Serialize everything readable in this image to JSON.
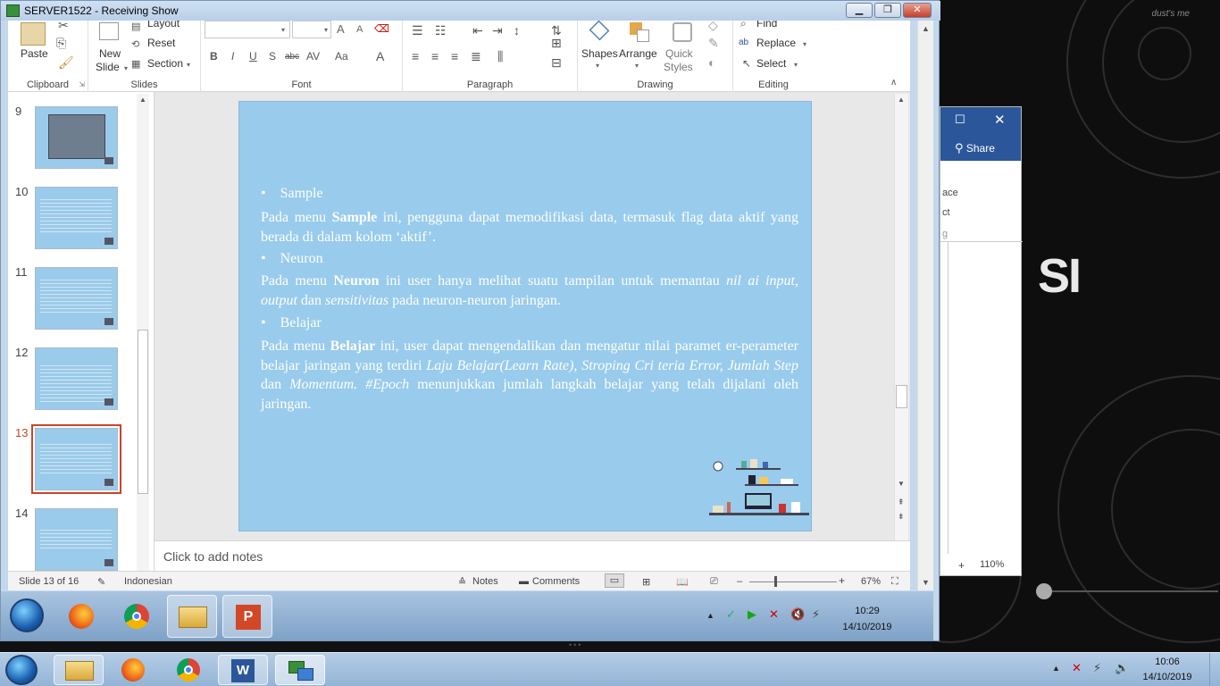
{
  "remote_window": {
    "title": "SERVER1522 - Receiving Show"
  },
  "ribbon": {
    "clipboard": {
      "paste": "Paste",
      "label": "Clipboard"
    },
    "slides": {
      "new_slide_1": "New",
      "new_slide_2": "Slide",
      "layout": "Layout",
      "reset": "Reset",
      "section": "Section",
      "label": "Slides"
    },
    "font": {
      "label": "Font",
      "bold": "B",
      "italic": "I",
      "underline": "U",
      "shadow": "S",
      "strike": "abc",
      "spacing": "AV",
      "case": "Aa",
      "color": "A",
      "grow": "A",
      "shrink": "A"
    },
    "paragraph": {
      "label": "Paragraph"
    },
    "drawing": {
      "shapes": "Shapes",
      "arrange": "Arrange",
      "quick_styles_1": "Quick",
      "quick_styles_2": "Styles",
      "label": "Drawing"
    },
    "editing": {
      "find": "Find",
      "replace": "Replace",
      "select": "Select",
      "label": "Editing"
    }
  },
  "thumbnails": [
    {
      "num": "9"
    },
    {
      "num": "10"
    },
    {
      "num": "11"
    },
    {
      "num": "12"
    },
    {
      "num": "13"
    },
    {
      "num": "14"
    }
  ],
  "slide": {
    "bullet1": "Sample",
    "p1_a": "Pada menu ",
    "p1_b": "Sample",
    "p1_c": " ini, pengguna dapat memodifikasi data, termasuk flag data aktif yang berada di dalam kolom ‘aktif’.",
    "bullet2": "Neuron",
    "p2_a": "Pada menu ",
    "p2_b": "Neuron",
    "p2_c": " ini user hanya melihat suatu tampilan untuk memantau ",
    "p2_d": "nil ai input, output",
    "p2_e": " dan ",
    "p2_f": "sensitivitas",
    "p2_g": " pada neuron-neuron jaringan.",
    "bullet3": "Belajar",
    "p3_a": "Pada menu ",
    "p3_b": "Belajar",
    "p3_c": " ini, user dapat mengendalikan dan mengatur nilai paramet er-perameter belajar jaringan yang terdiri ",
    "p3_d": "Laju Belajar(Learn Rate), Stroping Cri teria Error, Jumlah Step",
    "p3_e": " dan ",
    "p3_f": "Momentum. #Epoch",
    "p3_g": " menunjukkan jumlah langkah belajar yang telah dijalani oleh jaringan."
  },
  "notes": {
    "placeholder": "Click to add notes"
  },
  "status": {
    "slide": "Slide 13 of 16",
    "language": "Indonesian",
    "notes": "Notes",
    "comments": "Comments",
    "zoom": "67%"
  },
  "inner_taskbar": {
    "time": "10:29",
    "date": "14/10/2019"
  },
  "outer_taskbar": {
    "time": "10:06",
    "date": "14/10/2019"
  },
  "word_bg": {
    "share": "Share",
    "zoom": "110%",
    "frag1": "ace",
    "frag2": "ct",
    "frag3": "g"
  },
  "wallpaper": {
    "text": "dust's me",
    "brand": "SI"
  }
}
